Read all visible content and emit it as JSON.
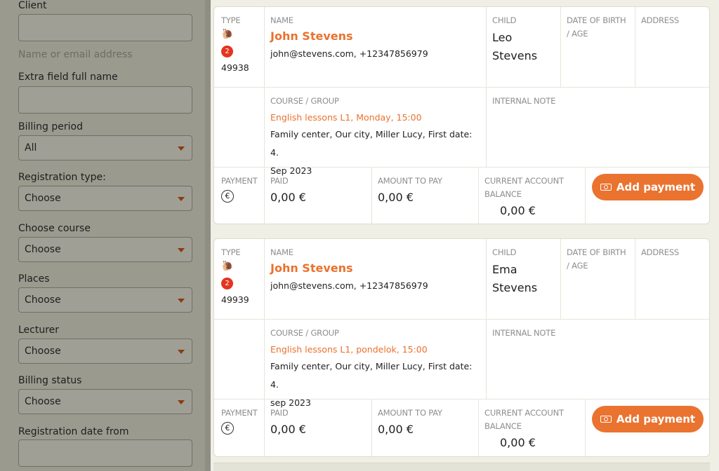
{
  "filters": {
    "client_label": "Client",
    "client_hint": "Name or email address",
    "extra_field_label": "Extra field full name",
    "billing_period_label": "Billing period",
    "billing_period_value": "All",
    "registration_type_label": "Registration type:",
    "registration_type_value": "Choose",
    "course_label": "Choose course",
    "course_value": "Choose",
    "places_label": "Places",
    "places_value": "Choose",
    "lecturer_label": "Lecturer",
    "lecturer_value": "Choose",
    "billing_status_label": "Billing status",
    "billing_status_value": "Choose",
    "reg_date_from_label": "Registration date from"
  },
  "headers": {
    "type": "TYPE",
    "name": "NAME",
    "child": "CHILD",
    "dob": "DATE OF BIRTH / AGE",
    "address": "ADDRESS",
    "course": "COURSE / GROUP",
    "note": "INTERNAL NOTE",
    "payment": "PAYMENT",
    "paid": "PAID",
    "amount": "AMOUNT TO PAY",
    "balance": "CURRENT ACCOUNT BALANCE"
  },
  "add_payment_label": "Add payment",
  "registrations": [
    {
      "badge": "2",
      "id": "49938",
      "name": "John Stevens",
      "contact": "john@stevens.com, +12347856979",
      "child_first": "Leo",
      "child_last": "Stevens",
      "course": "English lessons L1, Monday, 15:00",
      "place_line1": "Family center, Our city, Miller Lucy, First date: 4.",
      "place_line2": "Sep 2023",
      "paid": "0,00 €",
      "amount": "0,00 €",
      "balance": "0,00 €"
    },
    {
      "badge": "2",
      "id": "49939",
      "name": "John Stevens",
      "contact": "john@stevens.com, +12347856979",
      "child_first": "Ema",
      "child_last": "Stevens",
      "course": "English lessons L1, pondelok, 15:00",
      "place_line1": "Family center, Our city, Miller Lucy, First date: 4.",
      "place_line2": "sep 2023",
      "paid": "0,00 €",
      "amount": "0,00 €",
      "balance": "0,00 €"
    }
  ],
  "colors": {
    "accent": "#ea7330",
    "badge": "#e5341f"
  }
}
